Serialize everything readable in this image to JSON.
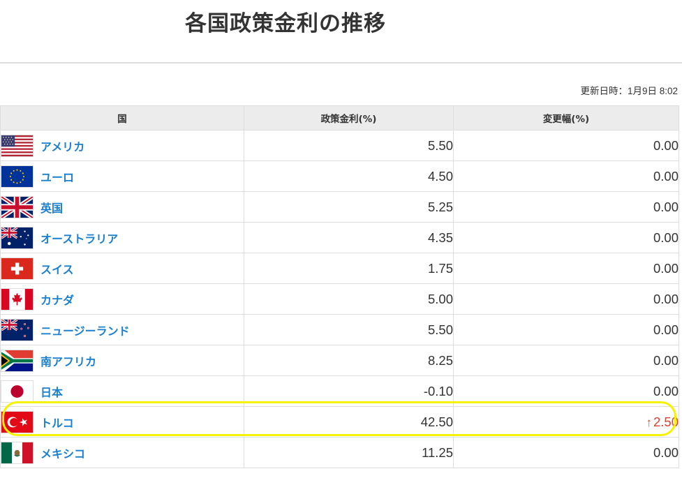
{
  "header": {
    "title": "各国政策金利の推移"
  },
  "updated": {
    "text": "更新日時：1月9日 8:02"
  },
  "table": {
    "columns": [
      "国",
      "政策金利(%)",
      "変更幅(%)"
    ],
    "rows": [
      {
        "country": "アメリカ",
        "flag": "us-flag",
        "rate": "5.50",
        "change": "0.00"
      },
      {
        "country": "ユーロ",
        "flag": "eu-flag",
        "rate": "4.50",
        "change": "0.00"
      },
      {
        "country": "英国",
        "flag": "uk-flag",
        "rate": "5.25",
        "change": "0.00"
      },
      {
        "country": "オーストラリア",
        "flag": "australia-flag",
        "rate": "4.35",
        "change": "0.00"
      },
      {
        "country": "スイス",
        "flag": "switzerland-flag",
        "rate": "1.75",
        "change": "0.00"
      },
      {
        "country": "カナダ",
        "flag": "canada-flag",
        "rate": "5.00",
        "change": "0.00"
      },
      {
        "country": "ニュージーランド",
        "flag": "new-zealand-flag",
        "rate": "5.50",
        "change": "0.00"
      },
      {
        "country": "南アフリカ",
        "flag": "south-africa-flag",
        "rate": "8.25",
        "change": "0.00"
      },
      {
        "country": "日本",
        "flag": "japan-flag",
        "rate": "-0.10",
        "change": "0.00"
      },
      {
        "country": "トルコ",
        "flag": "turkey-flag",
        "rate": "42.50",
        "change": "2.50",
        "change_direction": "up",
        "change_icon": "arrow-up-icon"
      },
      {
        "country": "メキシコ",
        "flag": "mexico-flag",
        "rate": "11.25",
        "change": "0.00"
      }
    ]
  },
  "colors": {
    "link": "#1a7fcf",
    "increase": "#e0402e",
    "highlight": "#f5f200",
    "header_bg": "#ececec"
  }
}
